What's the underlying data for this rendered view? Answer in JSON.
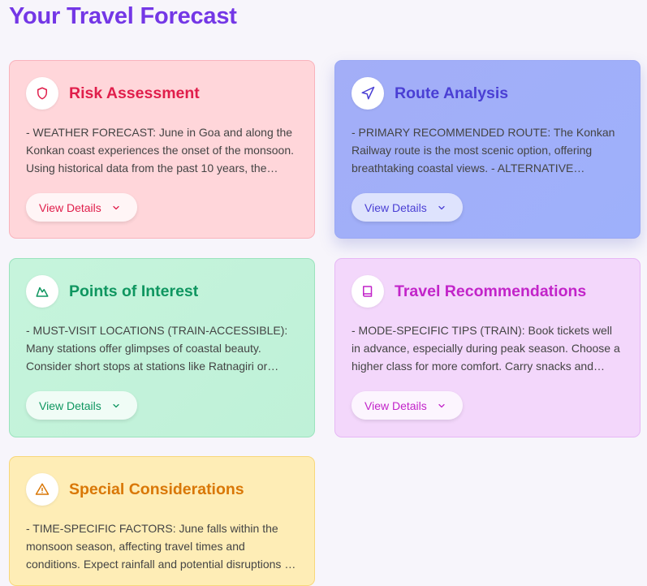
{
  "page": {
    "title": "Your Travel Forecast"
  },
  "colors": {
    "title": "#7437e6",
    "risk": "#e01e4b",
    "route": "#4a3fd4",
    "poi": "#0f9660",
    "travel": "#c224c9",
    "special": "#d97706"
  },
  "cards": [
    {
      "id": "risk",
      "icon": "shield-icon",
      "title": "Risk Assessment",
      "body": "- WEATHER FORECAST: June in Goa and along the Konkan coast experiences the onset of the monsoon. Using historical data from the past 10 years, the region receives heavy rainfall during this period.",
      "button_label": "View Details"
    },
    {
      "id": "route",
      "icon": "navigation-icon",
      "title": "Route Analysis",
      "body": "- PRIMARY RECOMMENDED ROUTE: The Konkan Railway route is the most scenic option, offering breathtaking coastal views. - ALTERNATIVE ROUTES: road travel along the coastal highway is possible.",
      "button_label": "View Details"
    },
    {
      "id": "poi",
      "icon": "mountain-icon",
      "title": "Points of Interest",
      "body": "- MUST-VISIT LOCATIONS (TRAIN-ACCESSIBLE): Many stations offer glimpses of coastal beauty. Consider short stops at stations like Ratnagiri or Kudal to explore nearby attractions.",
      "button_label": "View Details"
    },
    {
      "id": "travel",
      "icon": "book-icon",
      "title": "Travel Recommendations",
      "body": "- MODE-SPECIFIC TIPS (TRAIN): Book tickets well in advance, especially during peak season. Choose a higher class for more comfort. Carry snacks and water for the journey.",
      "button_label": "View Details"
    },
    {
      "id": "special",
      "icon": "warning-icon",
      "title": "Special Considerations",
      "body": "- TIME-SPECIFIC FACTORS: June falls within the monsoon season, affecting travel times and conditions. Expect rainfall and potential disruptions to schedules.",
      "button_label": "View Details"
    }
  ]
}
